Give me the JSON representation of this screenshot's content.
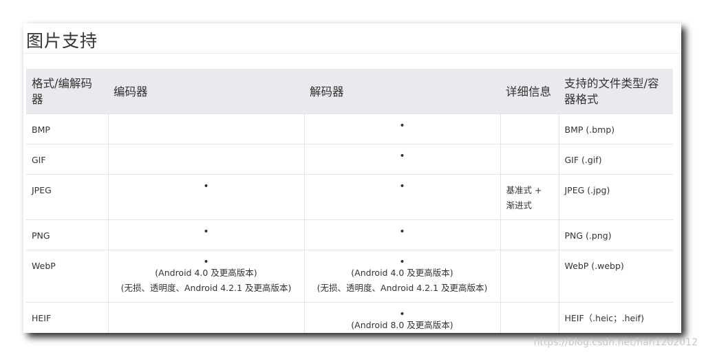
{
  "page": {
    "title": "图片支持",
    "watermark": "https://blog.csdn.net/han1202012"
  },
  "table": {
    "headers": [
      "格式/编解码器",
      "编码器",
      "解码器",
      "详细信息",
      "支持的文件类型/容器格式"
    ],
    "rows": [
      {
        "format": "BMP",
        "encoder": [],
        "decoder": [
          "•"
        ],
        "details": "",
        "file_types": "BMP (.bmp)"
      },
      {
        "format": "GIF",
        "encoder": [],
        "decoder": [
          "•"
        ],
        "details": "",
        "file_types": "GIF (.gif)"
      },
      {
        "format": "JPEG",
        "encoder": [
          "•"
        ],
        "decoder": [
          "•"
        ],
        "details": "基准式 + 渐进式",
        "file_types": "JPEG (.jpg)"
      },
      {
        "format": "PNG",
        "encoder": [
          "•"
        ],
        "decoder": [
          "•"
        ],
        "details": "",
        "file_types": "PNG (.png)"
      },
      {
        "format": "WebP",
        "encoder": [
          "•",
          "(Android 4.0 及更高版本)",
          "(无损、透明度、Android 4.2.1 及更高版本)"
        ],
        "decoder": [
          "•",
          "(Android 4.0 及更高版本)",
          "(无损、透明度、Android 4.2.1 及更高版本)"
        ],
        "details": "",
        "file_types": "WebP (.webp)"
      },
      {
        "format": "HEIF",
        "encoder": [],
        "decoder": [
          "•",
          "(Android 8.0 及更高版本)"
        ],
        "details": "",
        "file_types": "HEIF（.heic；.heif)"
      }
    ]
  }
}
